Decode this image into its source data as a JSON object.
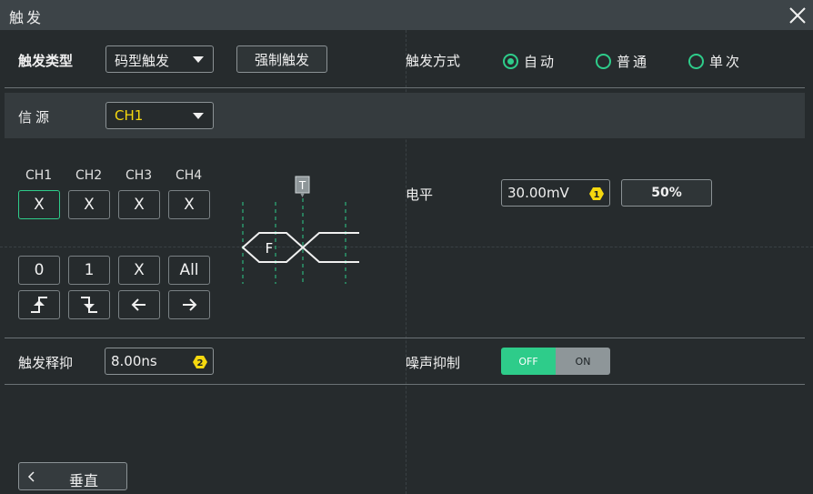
{
  "window": {
    "title": "触发"
  },
  "trigger": {
    "type_label": "触发类型",
    "type_value": "码型触发",
    "force_label": "强制触发",
    "mode_label": "触发方式",
    "modes": [
      {
        "label": "自动",
        "selected": true
      },
      {
        "label": "普通",
        "selected": false
      },
      {
        "label": "单次",
        "selected": false
      }
    ]
  },
  "source": {
    "label": "信源",
    "value": "CH1"
  },
  "pattern": {
    "channels": [
      {
        "name": "CH1",
        "value": "X"
      },
      {
        "name": "CH2",
        "value": "X"
      },
      {
        "name": "CH3",
        "value": "X"
      },
      {
        "name": "CH4",
        "value": "X"
      }
    ],
    "keys_row1": [
      "0",
      "1",
      "X",
      "All"
    ],
    "diagram_marker": "T",
    "diagram_label": "F"
  },
  "level": {
    "label": "电平",
    "value": "30.00mV",
    "badge": "1",
    "fifty_label": "50%"
  },
  "holdoff": {
    "label": "触发释抑",
    "value": "8.00ns",
    "badge": "2"
  },
  "noise": {
    "label": "噪声抑制",
    "off_label": "OFF",
    "on_label": "ON",
    "state": "OFF"
  },
  "nav": {
    "back_label": "垂直"
  },
  "colors": {
    "accent": "#2ecc8a",
    "badge": "#f5d80f",
    "source_text": "#f5d80f"
  }
}
